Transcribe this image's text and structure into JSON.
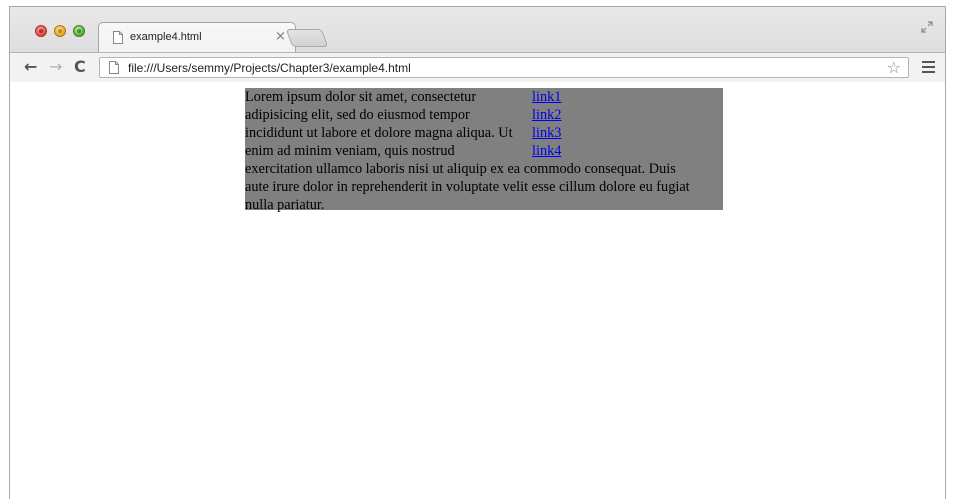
{
  "browser": {
    "tab_title": "example4.html",
    "tab_close": "×",
    "url": "file:///Users/semmy/Projects/Chapter3/example4.html",
    "back_glyph": "←",
    "forward_glyph": "→",
    "reload_glyph": "C",
    "star_glyph": "☆"
  },
  "page": {
    "background_color": "#808080",
    "paragraph_lines": [
      "Lorem ipsum dolor sit amet, consectetur",
      "adipisicing elit, sed do eiusmod tempor",
      "incididunt ut labore et dolore magna aliqua. Ut",
      "enim ad minim veniam, quis nostrud",
      "exercitation ullamco laboris nisi ut aliquip ex ea commodo consequat. Duis",
      "aute irure dolor in reprehenderit in voluptate velit esse cillum dolore eu fugiat",
      "nulla pariatur."
    ],
    "links": [
      "link1",
      "link2",
      "link3",
      "link4"
    ]
  }
}
